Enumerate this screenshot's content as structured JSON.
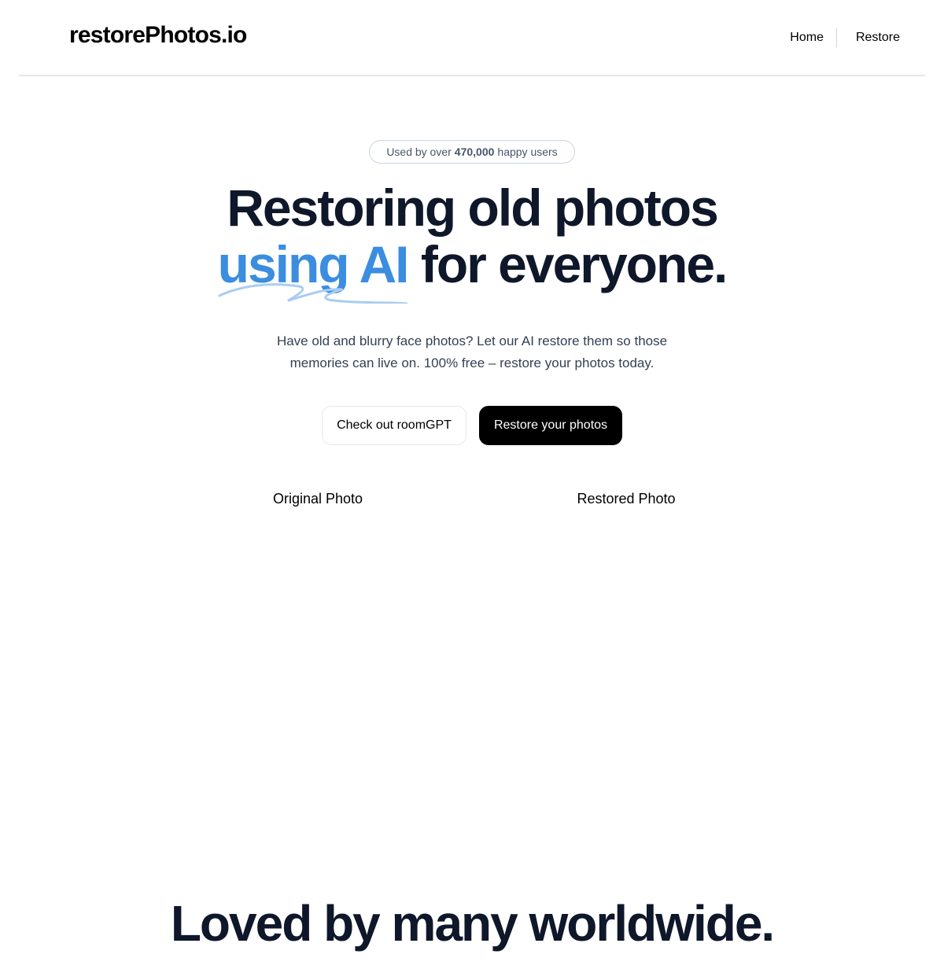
{
  "header": {
    "logo": "restorePhotos.io",
    "nav": {
      "home": "Home",
      "restore": "Restore"
    }
  },
  "badge": {
    "prefix": "Used by over",
    "count": "470,000",
    "suffix": "happy users"
  },
  "hero": {
    "title_line1": "Restoring old photos",
    "title_accent": "using AI",
    "title_line2_rest": "for everyone.",
    "subtitle": "Have old and blurry face photos? Let our AI restore them so those memories can live on. 100% free – restore your photos today.",
    "accent_color": "#3b8de0"
  },
  "buttons": {
    "secondary": "Check out roomGPT",
    "primary": "Restore your photos"
  },
  "comparison": {
    "original_label": "Original Photo",
    "restored_label": "Restored Photo"
  },
  "testimonials": {
    "title": "Loved by many worldwide."
  }
}
